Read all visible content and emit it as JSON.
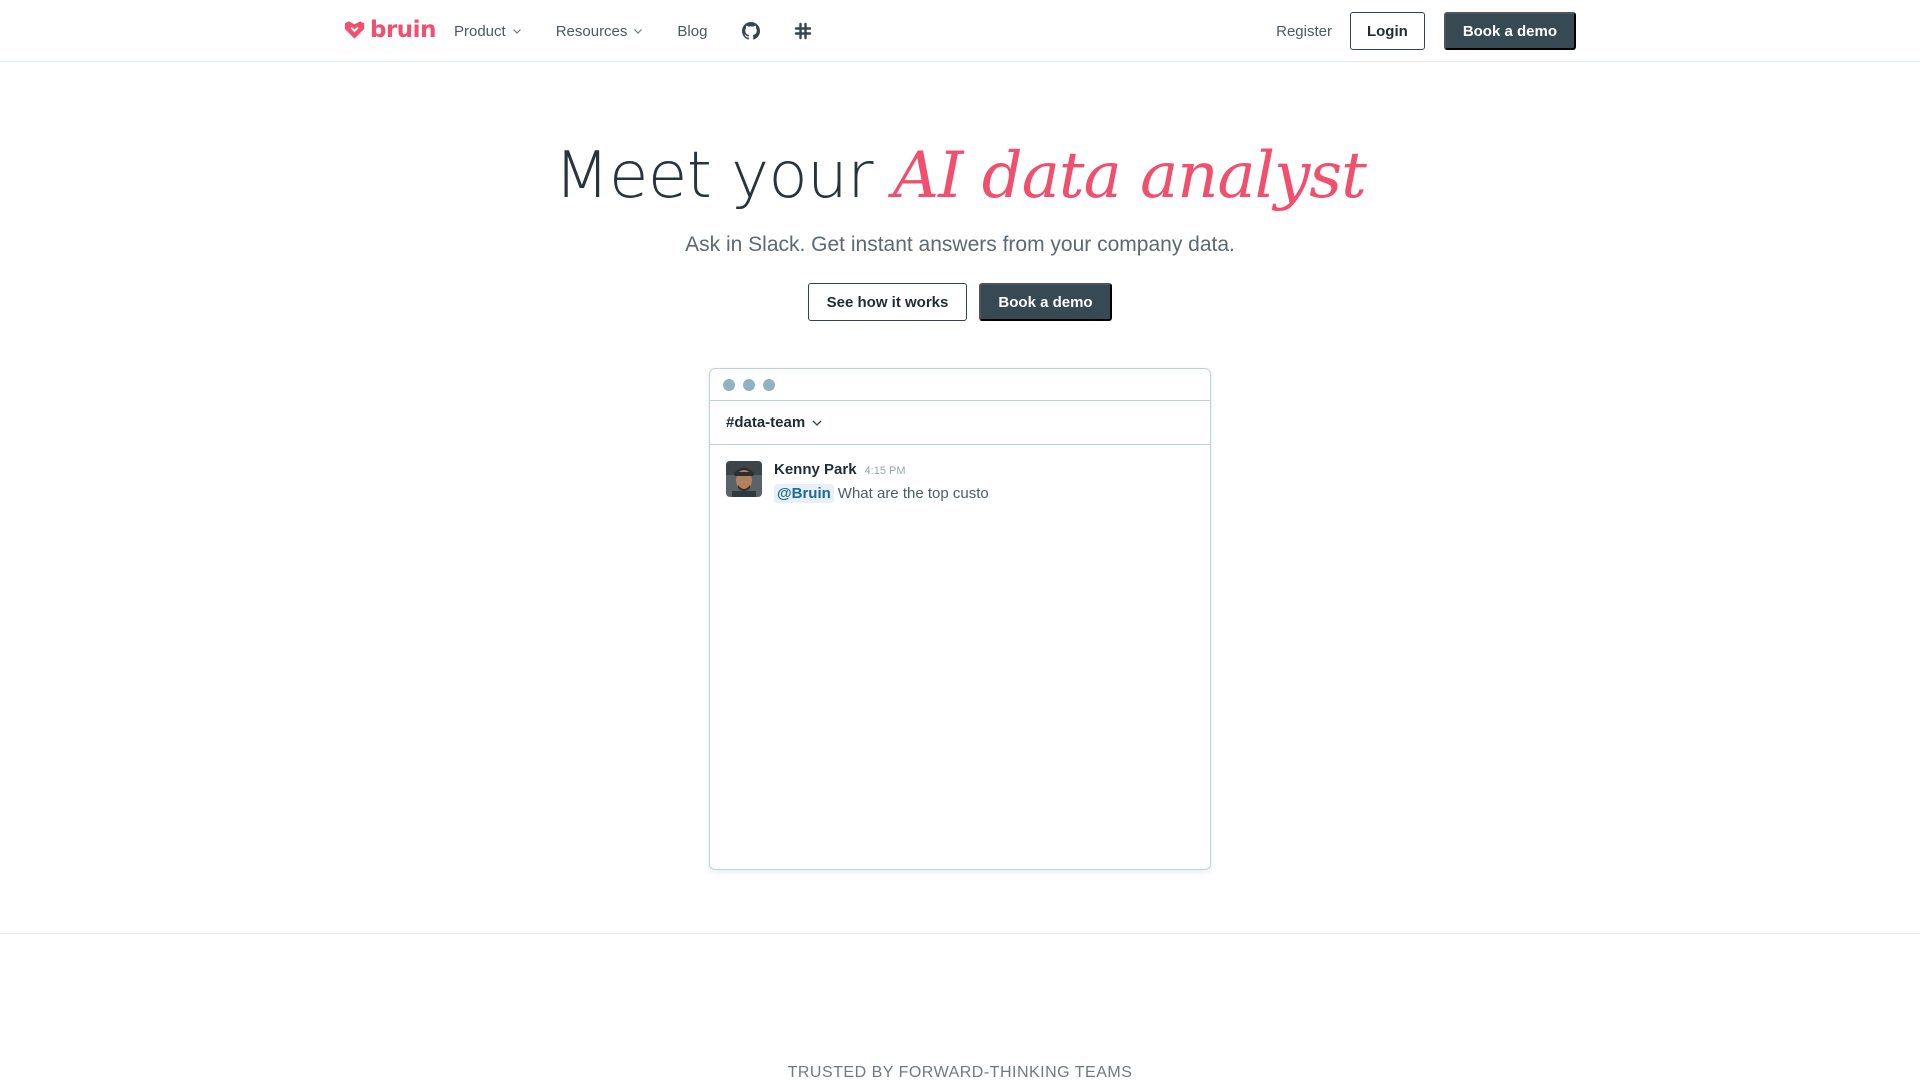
{
  "brand": {
    "name": "bruin",
    "color": "#f0506e"
  },
  "nav": {
    "items": [
      {
        "label": "Product",
        "icon": "chevron-down-icon"
      },
      {
        "label": "Resources",
        "icon": "chevron-down-icon"
      },
      {
        "label": "Blog"
      }
    ],
    "icons": [
      "github-icon",
      "slack-icon"
    ],
    "register_label": "Register",
    "login_label": "Login",
    "book_demo_label": "Book a demo"
  },
  "hero": {
    "title_plain": "Meet your",
    "title_accent": "AI data analyst",
    "subtitle": "Ask in Slack. Get instant answers from your company data.",
    "secondary_cta": "See how it works",
    "primary_cta": "Book a demo"
  },
  "slack_window": {
    "channel": "#data-team",
    "message": {
      "author": "Kenny Park",
      "time": "4:15 PM",
      "mention": "@Bruin",
      "text": "What are the top custo"
    }
  },
  "trusted": {
    "label": "TRUSTED BY FORWARD-THINKING TEAMS"
  },
  "colors": {
    "accent": "#f0506e",
    "dark_button": "#374952",
    "window_border": "#b9d5df",
    "mention_bg": "#e6f0f6",
    "mention_text": "#1d6a9a"
  }
}
